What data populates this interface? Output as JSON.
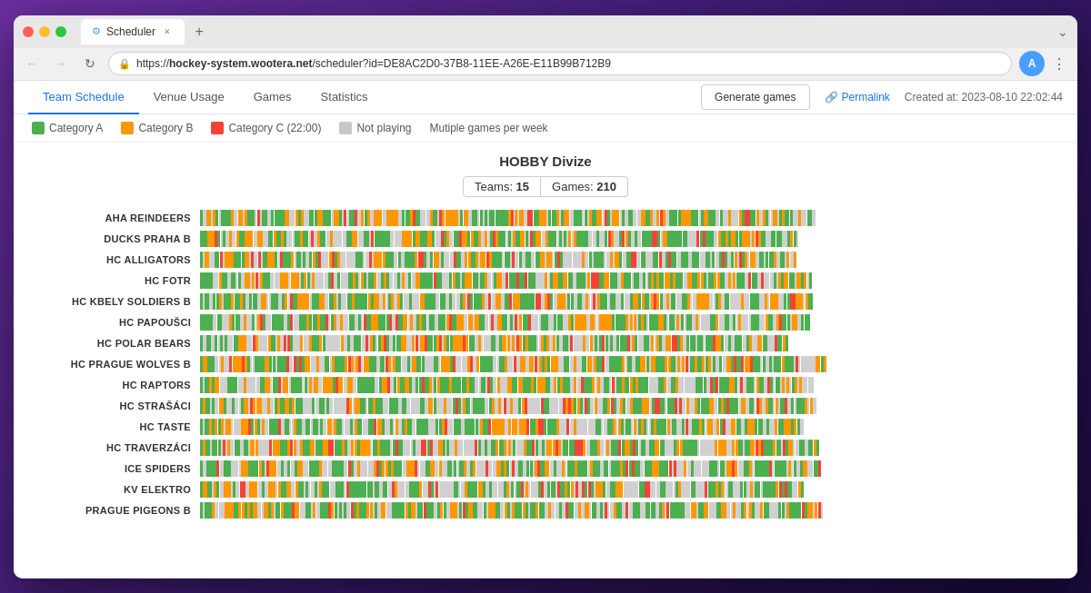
{
  "browser": {
    "title": "Scheduler",
    "url_display": "https://hockey-system.wootera.net/scheduler?id=DE8AC2D0-37B8-11EE-A26E-E11B99B712B9",
    "url_bold": "hockey-system.wootera.net",
    "url_prefix": "https://",
    "url_suffix": "/scheduler?id=DE8AC2D0-37B8-11EE-A26E-E11B99B712B9",
    "user_initial": "A"
  },
  "nav": {
    "tabs": [
      "Team Schedule",
      "Venue Usage",
      "Games",
      "Statistics"
    ],
    "active_tab": "Team Schedule",
    "generate_label": "Generate games",
    "permalink_label": "Permalink",
    "created_at": "Created at: 2023-08-10 22:02:44"
  },
  "legend": {
    "items": [
      {
        "label": "Category A",
        "class": "cat-a"
      },
      {
        "label": "Category B",
        "class": "cat-b"
      },
      {
        "label": "Category C (22:00)",
        "class": "cat-c"
      },
      {
        "label": "Not playing",
        "class": "not-playing"
      }
    ],
    "multiple_label": "Mutiple games per week"
  },
  "division": {
    "title": "HOBBY Divize",
    "teams_count": "15",
    "games_count": "210"
  },
  "teams": [
    "AHA REINDEERS",
    "DUCKS PRAHA B",
    "HC ALLIGATORS",
    "HC FOTR",
    "HC KBELY SOLDIERS B",
    "HC PAPOUŠCI",
    "HC POLAR BEARS",
    "HC PRAGUE WOLVES B",
    "HC RAPTORS",
    "HC STRAŠÁCI",
    "HC TASTE",
    "HC TRAVERZÁCI",
    "ICE SPIDERS",
    "KV ELEKTRO",
    "PRAGUE PIGEONS B"
  ]
}
